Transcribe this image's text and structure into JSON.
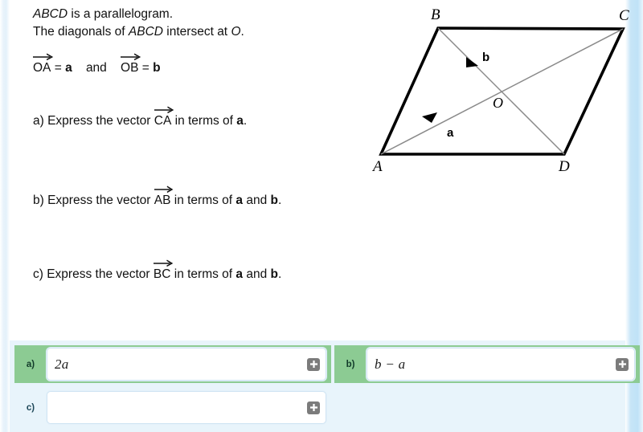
{
  "question": {
    "stem_line1_pre": "",
    "stem_line1_italic": "ABCD",
    "stem_line1_post": " is a parallelogram.",
    "stem_line2_pre": "The diagonals of ",
    "stem_line2_italic": "ABCD",
    "stem_line2_post": " intersect at ",
    "stem_line2_italic2": "O",
    "stem_line2_end": ".",
    "given_vec1": "OA",
    "given_eq1": " = ",
    "given_val1": "a",
    "given_conj": "and",
    "given_vec2": "OB",
    "given_eq2": " = ",
    "given_val2": "b",
    "parts": [
      {
        "id": "a",
        "prefix": "a) Express the vector ",
        "vector": "CA",
        "middle": " in terms of ",
        "terms": "a",
        "suffix": "."
      },
      {
        "id": "b",
        "prefix": "b) Express the vector ",
        "vector": "AB",
        "middle": " in terms of ",
        "terms": "a",
        "conj": " and ",
        "terms2": "b",
        "suffix": "."
      },
      {
        "id": "c",
        "prefix": "c) Express the vector ",
        "vector": "BC",
        "middle": " in terms of ",
        "terms": "a",
        "conj": " and ",
        "terms2": "b",
        "suffix": "."
      }
    ]
  },
  "diagram": {
    "vertices": {
      "A": "A",
      "B": "B",
      "C": "C",
      "D": "D",
      "O": "O"
    },
    "vector_labels": {
      "a": "a",
      "b": "b"
    },
    "shape": "parallelogram",
    "outline_color": "#000000",
    "diagonal_color": "#808080"
  },
  "answers": {
    "rows": [
      {
        "id": "a",
        "label": "a)",
        "value": "2a",
        "state": "correct",
        "add_icon": "plus-icon"
      },
      {
        "id": "b",
        "label": "b)",
        "value": "b − a",
        "state": "correct",
        "add_icon": "plus-icon"
      },
      {
        "id": "c",
        "label": "c)",
        "value": "",
        "state": "blank",
        "add_icon": "plus-icon"
      }
    ]
  },
  "colors": {
    "correct_green": "#8ccb93",
    "panel_blue": "#e8f4fb",
    "field_border": "#cfe4f3",
    "plus_button": "#7b7b7b",
    "label_text": "#1d4758"
  }
}
